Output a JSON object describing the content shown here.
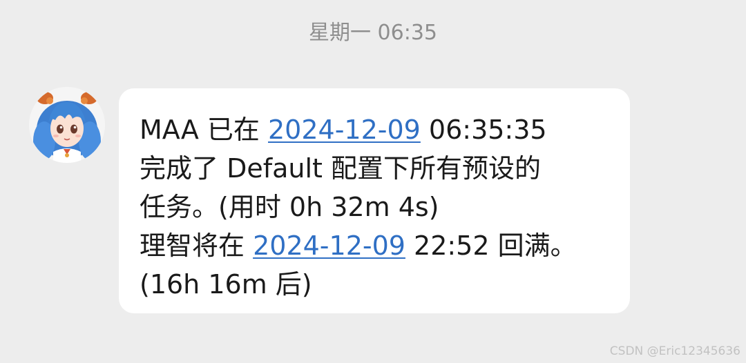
{
  "timestamp": "星期一 06:35",
  "avatar": {
    "name": "MAA"
  },
  "message": {
    "line1": {
      "before": "MAA 已在 ",
      "date": "2024-12-09",
      "after": " 06:35:35"
    },
    "line2": "完成了 Default 配置下所有预设的",
    "line3": "任务。(用时 0h 32m 4s)",
    "line4": {
      "before": "理智将在 ",
      "date": "2024-12-09",
      "after": " 22:52 回满。"
    },
    "line5": "(16h 16m 后)"
  },
  "watermark": "CSDN @Eric12345636",
  "colors": {
    "background": "#ededed",
    "bubble": "#ffffff",
    "link": "#2f6fc4",
    "timestamp": "#8e8e8e"
  }
}
